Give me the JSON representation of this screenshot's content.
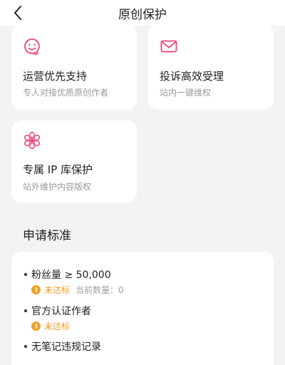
{
  "header": {
    "title": "原创保护"
  },
  "benefits": [
    {
      "title": "运营优先支持",
      "subtitle": "专人对接优质原创作者",
      "icon": "smile-face-icon",
      "color": "#f0457a"
    },
    {
      "title": "投诉高效受理",
      "subtitle": "站内一键维权",
      "icon": "mail-icon",
      "color": "#f0457a"
    },
    {
      "title": "专属 IP 库保护",
      "subtitle": "站外维护内容版权",
      "icon": "flower-icon",
      "color": "#f0457a"
    }
  ],
  "requirements": {
    "title": "申请标准",
    "items": [
      {
        "title": "粉丝量 ≥ 50,000",
        "status": "未达标",
        "count": "当前数量：0"
      },
      {
        "title": "官方认证作者",
        "status": "未达标"
      },
      {
        "title": "无笔记违规记录"
      }
    ]
  },
  "colors": {
    "accent": "#f0457a",
    "warning": "#f5a12a"
  }
}
